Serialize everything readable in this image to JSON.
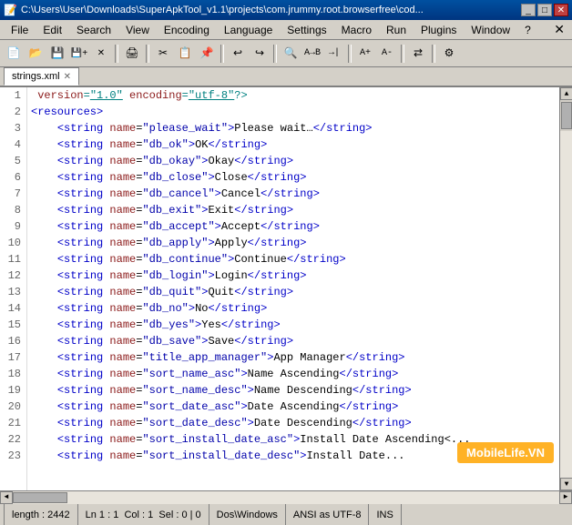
{
  "window": {
    "title": "C:\\Users\\User\\Downloads\\SuperApkTool_v1.1\\projects\\com.jrummy.root.browserfree\\cod...",
    "icon": "📄"
  },
  "menubar": {
    "items": [
      "File",
      "Edit",
      "Search",
      "View",
      "Encoding",
      "Language",
      "Settings",
      "Macro",
      "Run",
      "Plugins",
      "Window",
      "?"
    ],
    "close": "✕"
  },
  "tab": {
    "filename": "strings.xml",
    "close": "✕"
  },
  "lines": [
    {
      "num": "1",
      "content": "<?xml version=\"1.0\" encoding=\"utf-8\"?>"
    },
    {
      "num": "2",
      "content": "<resources>"
    },
    {
      "num": "3",
      "content": "    <string name=\"please_wait\">Please wait…</string>"
    },
    {
      "num": "4",
      "content": "    <string name=\"db_ok\">OK</string>"
    },
    {
      "num": "5",
      "content": "    <string name=\"db_okay\">Okay</string>"
    },
    {
      "num": "6",
      "content": "    <string name=\"db_close\">Close</string>"
    },
    {
      "num": "7",
      "content": "    <string name=\"db_cancel\">Cancel</string>"
    },
    {
      "num": "8",
      "content": "    <string name=\"db_exit\">Exit</string>"
    },
    {
      "num": "9",
      "content": "    <string name=\"db_accept\">Accept</string>"
    },
    {
      "num": "10",
      "content": "    <string name=\"db_apply\">Apply</string>"
    },
    {
      "num": "11",
      "content": "    <string name=\"db_continue\">Continue</string>"
    },
    {
      "num": "12",
      "content": "    <string name=\"db_login\">Login</string>"
    },
    {
      "num": "13",
      "content": "    <string name=\"db_quit\">Quit</string>"
    },
    {
      "num": "14",
      "content": "    <string name=\"db_no\">No</string>"
    },
    {
      "num": "15",
      "content": "    <string name=\"db_yes\">Yes</string>"
    },
    {
      "num": "16",
      "content": "    <string name=\"db_save\">Save</string>"
    },
    {
      "num": "17",
      "content": "    <string name=\"title_app_manager\">App Manager</string>"
    },
    {
      "num": "18",
      "content": "    <string name=\"sort_name_asc\">Name Ascending</string>"
    },
    {
      "num": "19",
      "content": "    <string name=\"sort_name_desc\">Name Descending</string>"
    },
    {
      "num": "20",
      "content": "    <string name=\"sort_date_asc\">Date Ascending</string>"
    },
    {
      "num": "21",
      "content": "    <string name=\"sort_date_desc\">Date Descending</string>"
    },
    {
      "num": "22",
      "content": "    <string name=\"sort_install_date_asc\">Install Date Ascending<..."
    },
    {
      "num": "23",
      "content": "    <string name=\"sort_install_date_desc\">Install Date..."
    }
  ],
  "status": {
    "length": "length : 2442",
    "position": "Ln 1 : 1",
    "col": "Col : 1",
    "sel": "Sel : 0 | 0",
    "encoding": "Dos\\Windows",
    "charset": "ANSI as UTF-8",
    "mode": "INS"
  },
  "watermark": "MobileLife.VN",
  "toolbar": {
    "buttons": [
      "new",
      "open",
      "save",
      "save-all",
      "close",
      "sep1",
      "print",
      "sep2",
      "cut",
      "copy",
      "paste",
      "sep3",
      "undo",
      "redo",
      "sep4",
      "find",
      "find-replace",
      "goto",
      "sep5",
      "zoom-in",
      "zoom-out",
      "sep6",
      "sync",
      "sep7",
      "settings"
    ]
  }
}
